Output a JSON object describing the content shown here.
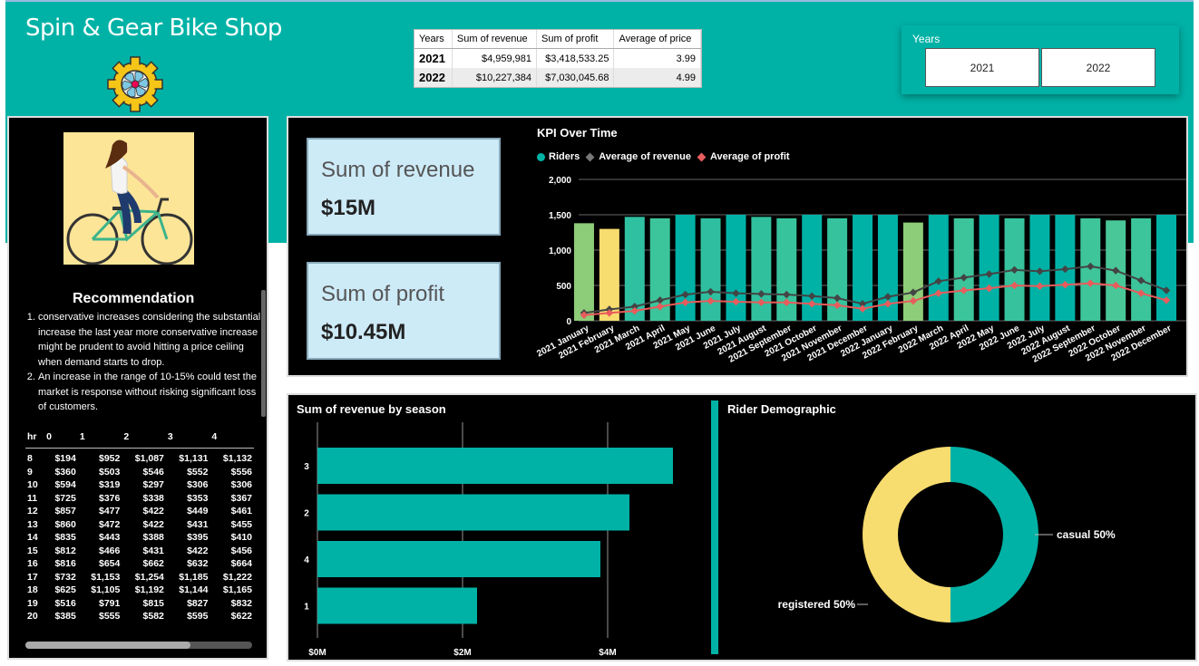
{
  "header": {
    "title": "Spin & Gear  Bike Shop",
    "logo_icon": "gear-icon"
  },
  "summary_table": {
    "columns": [
      "Years",
      "Sum of revenue",
      "Sum of profit",
      "Average of price"
    ],
    "rows": [
      {
        "year": "2021",
        "revenue": "$4,959,981",
        "profit": "$3,418,533.25",
        "price": "3.99"
      },
      {
        "year": "2022",
        "revenue": "$10,227,384",
        "profit": "$7,030,045.68",
        "price": "4.99"
      }
    ]
  },
  "slicer": {
    "title": "Years",
    "options": [
      "2021",
      "2022"
    ]
  },
  "left": {
    "image": "cyclist-illustration",
    "rec_title": "Recommendation",
    "rec_items": [
      "conservative increases considering the substantial  increase the last year more conservative  increase  might be  prudent  to avoid hitting a price ceiling when  demand starts to drop.",
      "An increase  in the range of 10-15%  could  test the market is response without risking significant loss of customers."
    ],
    "hr_table": {
      "headers": [
        "hr",
        "0",
        "1",
        "2",
        "3",
        "4"
      ],
      "rows": [
        [
          "8",
          "$194",
          "$952",
          "$1,087",
          "$1,131",
          "$1,132"
        ],
        [
          "9",
          "$360",
          "$503",
          "$546",
          "$552",
          "$556"
        ],
        [
          "10",
          "$594",
          "$319",
          "$297",
          "$306",
          "$306"
        ],
        [
          "11",
          "$725",
          "$376",
          "$338",
          "$353",
          "$367"
        ],
        [
          "12",
          "$857",
          "$477",
          "$422",
          "$449",
          "$461"
        ],
        [
          "13",
          "$860",
          "$472",
          "$422",
          "$431",
          "$455"
        ],
        [
          "14",
          "$835",
          "$443",
          "$388",
          "$395",
          "$410"
        ],
        [
          "15",
          "$812",
          "$466",
          "$431",
          "$422",
          "$456"
        ],
        [
          "16",
          "$816",
          "$654",
          "$662",
          "$632",
          "$664"
        ],
        [
          "17",
          "$732",
          "$1,153",
          "$1,254",
          "$1,185",
          "$1,222"
        ],
        [
          "18",
          "$625",
          "$1,105",
          "$1,192",
          "$1,144",
          "$1,165"
        ],
        [
          "19",
          "$516",
          "$791",
          "$815",
          "$827",
          "$832"
        ],
        [
          "20",
          "$385",
          "$555",
          "$582",
          "$595",
          "$622"
        ]
      ]
    }
  },
  "cards": {
    "revenue_label": "Sum of revenue",
    "revenue_value": "$15M",
    "profit_label": "Sum of profit",
    "profit_value": "$10.45M"
  },
  "chart_data": [
    {
      "type": "bar",
      "title": "KPI Over Time",
      "categories": [
        "2021 January",
        "2021 February",
        "2021 March",
        "2021 April",
        "2021 May",
        "2021 June",
        "2021 July",
        "2021 August",
        "2021 September",
        "2021 October",
        "2021 November",
        "2021 December",
        "2022 January",
        "2022 February",
        "2022 March",
        "2022 April",
        "2022 May",
        "2022 June",
        "2022 July",
        "2022 August",
        "2022 September",
        "2022 October",
        "2022 November",
        "2022 December"
      ],
      "ylim": [
        0,
        2000
      ],
      "yticks": [
        "0",
        "500",
        "1,000",
        "1,500",
        "2,000"
      ],
      "legend_position": "top-left",
      "series": [
        {
          "name": "Riders",
          "kind": "bar",
          "color": "#00b2a6",
          "values": [
            1380,
            1300,
            1470,
            1450,
            1500,
            1450,
            1500,
            1470,
            1450,
            1500,
            1450,
            1500,
            1500,
            1390,
            1500,
            1450,
            1500,
            1450,
            1500,
            1500,
            1450,
            1420,
            1450,
            1500
          ]
        },
        {
          "name": "Average of revenue",
          "kind": "line",
          "color": "#444444",
          "values": [
            110,
            160,
            200,
            290,
            370,
            410,
            390,
            380,
            370,
            350,
            320,
            240,
            340,
            400,
            560,
            610,
            660,
            720,
            700,
            730,
            770,
            710,
            570,
            430
          ]
        },
        {
          "name": "Average of profit",
          "kind": "line",
          "color": "#e85c5c",
          "values": [
            80,
            110,
            140,
            200,
            260,
            280,
            270,
            260,
            260,
            240,
            220,
            170,
            240,
            280,
            390,
            430,
            460,
            500,
            490,
            510,
            530,
            500,
            390,
            290
          ]
        }
      ]
    },
    {
      "type": "bar",
      "orientation": "horizontal",
      "title": "Sum of revenue by season",
      "categories": [
        "3",
        "2",
        "4",
        "1"
      ],
      "values": [
        4.9,
        4.3,
        3.9,
        2.2
      ],
      "xlim": [
        0,
        6
      ],
      "xticks": [
        "$0M",
        "$2M",
        "$4M"
      ],
      "color": "#00b2a6"
    },
    {
      "type": "pie",
      "title": "Rider Demographic",
      "slices": [
        {
          "label": "casual 50%",
          "value": 50,
          "color": "#00b2a6"
        },
        {
          "label": "registered 50%",
          "value": 50,
          "color": "#f7dc6f"
        }
      ]
    }
  ]
}
